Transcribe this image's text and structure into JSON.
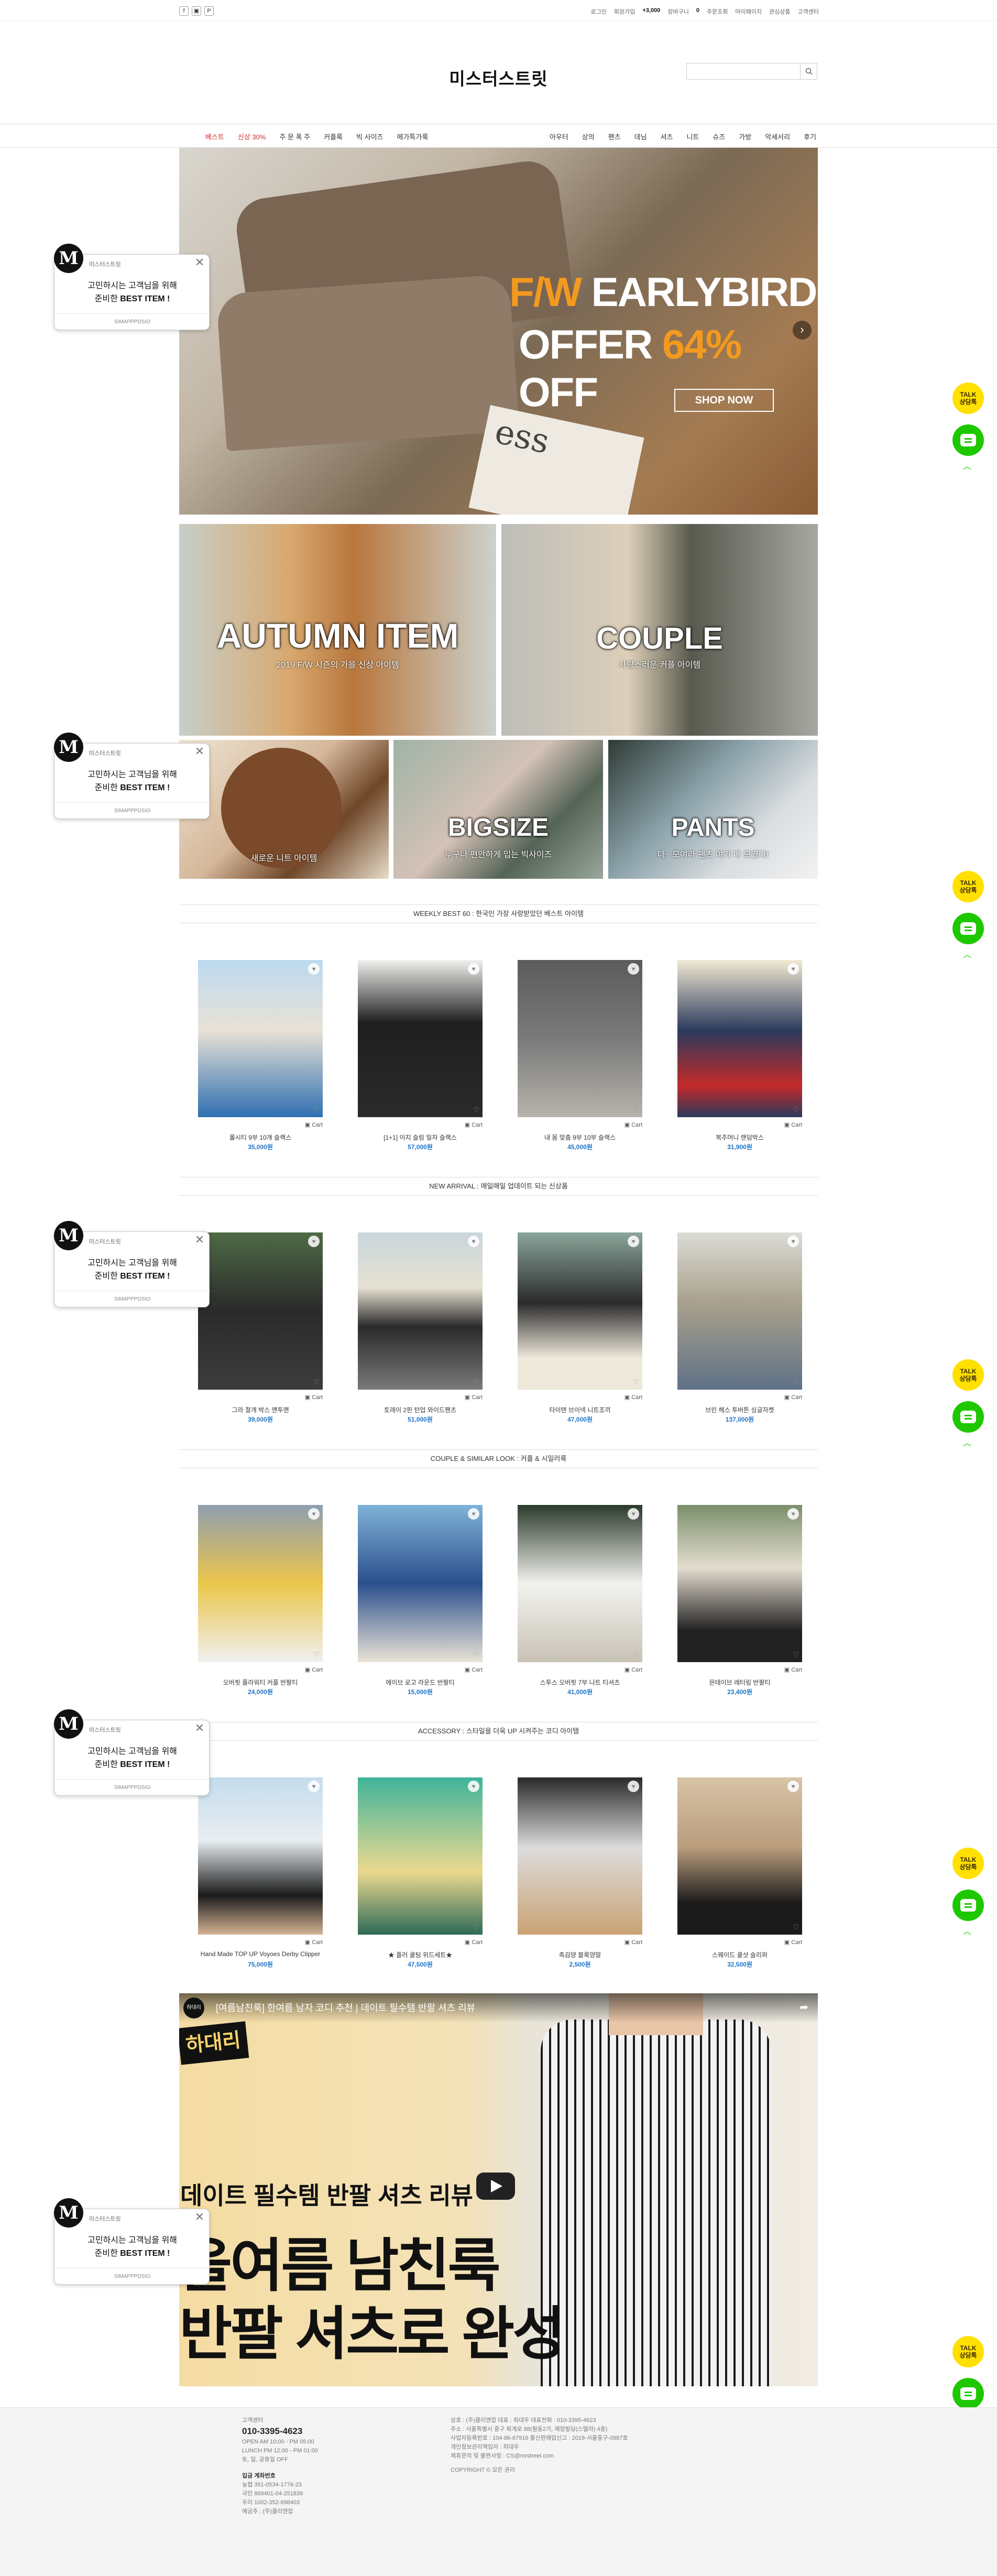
{
  "topbar": {
    "sns": [
      "f",
      "▣",
      "P"
    ],
    "util": [
      "로그인",
      "회원가입",
      "+3,000",
      "장바구니",
      "0",
      "주문조회",
      "마이페이지",
      "관심상품",
      "고객센터"
    ]
  },
  "header": {
    "logo": "미스터스트릿",
    "search_placeholder": ""
  },
  "nav": {
    "left": [
      "베스트",
      "신상 30%",
      "주 문 폭 주",
      "커플룩",
      "빅 사이즈",
      "메가특가룩"
    ],
    "right": [
      "아우터",
      "상의",
      "팬츠",
      "데님",
      "셔츠",
      "니트",
      "슈즈",
      "가방",
      "악세서리",
      "후기"
    ]
  },
  "hero": {
    "line1_a": "F/W ",
    "line1_b": "EARLYBIRD",
    "line2_a": "OFFER ",
    "line2_b": "64%",
    "line2_c": " OFF",
    "cta": "SHOP NOW",
    "paper_text": "ess"
  },
  "banners": {
    "autumn_title": "AUTUMN ITEM",
    "autumn_sub": "2019 F/W 시즌의 가을 신상 아이템",
    "couple_title": "COUPLE",
    "couple_sub": "사랑스러운 커플 아이템",
    "sm1_sub": "새로운 니트 아이템",
    "sm2_title": "BIGSIZE",
    "sm2_sub": "누구나 편안하게 입는 빅사이즈",
    "sm3_title": "PANTS",
    "sm3_sub": "다~ 모여라 팬츠 여기 다 모였다!"
  },
  "sections": [
    {
      "title": "WEEKLY BEST 60 : 한국인 가장 사랑받았던 베스트 아이템",
      "products": [
        {
          "name": "롤시티 9부 10개 슬랙스",
          "price": "35,000원",
          "img": "a"
        },
        {
          "name": "[1+1] 이지 슬림 일자 슬랙스",
          "price": "57,000원",
          "img": "b"
        },
        {
          "name": "내 몸 맞춤 9부 10부 슬랙스",
          "price": "45,000원",
          "img": "c"
        },
        {
          "name": "복주머니 랜덤박스",
          "price": "31,900원",
          "img": "d"
        }
      ]
    },
    {
      "title": "NEW ARRIVAL : 매일매일 업데이트 되는 신상품",
      "products": [
        {
          "name": "그라 절개 박스 맨투맨",
          "price": "39,000원",
          "img": "e"
        },
        {
          "name": "토레이 2핀 턴업 와이드팬츠",
          "price": "51,000원",
          "img": "f"
        },
        {
          "name": "타이텐 브이넥 니트조끼",
          "price": "47,000원",
          "img": "g"
        },
        {
          "name": "브린 헤스 투버튼 싱글자켓",
          "price": "137,000원",
          "img": "h"
        }
      ]
    },
    {
      "title": "COUPLE & SIMILAR LOOK : 커플 & 시밀러룩",
      "products": [
        {
          "name": "오버핏 플라워티 커플 반팔티",
          "price": "24,000원",
          "img": "i"
        },
        {
          "name": "에이브 로고 라운드 반팔티",
          "price": "15,000원",
          "img": "j"
        },
        {
          "name": "스투스 오버핏 7부 나트 티셔츠",
          "price": "41,000원",
          "img": "k"
        },
        {
          "name": "몬테이브 레터링 반팔티",
          "price": "23,400원",
          "img": "l"
        }
      ]
    },
    {
      "title": "ACCESSORY : 스타일을 더욱 UP 시켜주는 코디 아이템",
      "products": [
        {
          "name": "Hand Made TOP UP Voyoes Derby Clipper",
          "price": "75,000원",
          "img": "m"
        },
        {
          "name": "★ 플러 쿨팅 위드세트★",
          "price": "47,500원",
          "img": "n"
        },
        {
          "name": "촉감양 블록양말",
          "price": "2,500원",
          "img": "o"
        },
        {
          "name": "스웨이드 쿨샷 슬리퍼",
          "price": "32,500원",
          "img": "p"
        }
      ]
    }
  ],
  "product_labels": {
    "heart": "♥",
    "wish": "♡",
    "cart": "▣ Cart"
  },
  "popup": {
    "brand_letter": "M",
    "title": "미스터스트릿",
    "line1": "고민하시는 고객님을 위해",
    "line2_a": "준비한 ",
    "line2_b": "BEST ITEM !",
    "footer": "SIMAPPPOSIO",
    "close": "✕"
  },
  "floating": {
    "talk_a": "TALK",
    "talk_b": "상담톡",
    "top": "︿"
  },
  "video": {
    "channel": "하대리",
    "title": "[여름남친룩] 한여름 남자 코디 추천 | 데이트 필수템 반팔 셔츠 리뷰",
    "badge": "하대리",
    "line1": "데이트 필수템 반팔 셔츠 리뷰",
    "line2": "올여름 남친룩",
    "line3": "반팔 셔츠로 완성",
    "share": "➦"
  },
  "footer": {
    "cs_label": "고객센터",
    "phone": "010-3395-4623",
    "cs_lines": [
      "OPEN AM 10:00 - PM 05:00",
      "LUNCH PM 12:00 - PM 01:00",
      "토, 일, 공휴일 OFF"
    ],
    "bank_label": "입금 계좌번호",
    "bank_lines": [
      "농협 351-0534-1776-23",
      "국민 869401-04-251839",
      "우리 1002-352-698403",
      "예금주 : (주)클리앤잡"
    ],
    "company_lines": [
      "상호 : (주)클리앤잡 대표 : 최대우  대표전화 : 010-3395-4623",
      "주소 : 서울특별시 중구 퇴계로 88(필동2가, 재정빌딩(스텔라) 4층)",
      "사업자등록번호 : 104-86-87916 통신판매업신고 : 2019-서울중구-0987호",
      "개인정보관리책임자 : 최대우",
      "제휴문의 및 불편사항 : CS@mrstreet.com"
    ],
    "copyright": "COPYRIGHT © 모든 권리"
  }
}
